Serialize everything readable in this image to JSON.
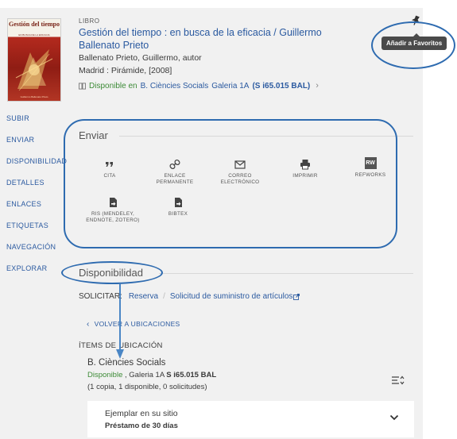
{
  "record": {
    "type_label": "LIBRO",
    "title": "Gestión del tiempo : en busca de la eficacia / Guillermo Ballenato Prieto",
    "author": "Ballenato Prieto, Guillermo, autor",
    "publisher": "Madrid : Pirámide, [2008]",
    "availability": {
      "status": "Disponible en",
      "library": "B. Ciències Socials",
      "location": "Galeria 1A",
      "callnumber": "(S i65.015 BAL)"
    },
    "cover": {
      "title": "Gestión del tiempo",
      "subtitle": "EN BUSCA DE LA EFICACIA",
      "footer": "Guillermo Ballenato Prieto"
    }
  },
  "favorites_tooltip": "Añadir a Favoritos",
  "nav": {
    "items": [
      "SUBIR",
      "ENVIAR",
      "DISPONIBILIDAD",
      "DETALLES",
      "ENLACES",
      "ETIQUETAS",
      "NAVEGACIÓN",
      "EXPLORAR"
    ]
  },
  "send": {
    "title": "Enviar",
    "actions": [
      {
        "label": "CITA",
        "icon": "quote-icon"
      },
      {
        "label": "ENLACE PERMANENTE",
        "icon": "link-icon"
      },
      {
        "label": "CORREO ELECTRÓNICO",
        "icon": "mail-icon"
      },
      {
        "label": "IMPRIMIR",
        "icon": "print-icon"
      },
      {
        "label": "REFWORKS",
        "icon": "refworks-icon",
        "badge": "RW"
      },
      {
        "label": "RIS (MENDELEY, ENDNOTE, ZOTERO)",
        "icon": "file-export-icon"
      },
      {
        "label": "BIBTEX",
        "icon": "file-export-icon"
      }
    ]
  },
  "availability_section": {
    "title": "Disponibilidad",
    "request_label": "SOLICITAR:",
    "request_links": [
      "Reserva",
      "Solicitud de suministro de artículos"
    ],
    "back_label": "VOLVER A UBICACIONES",
    "items_heading": "ÍTEMS DE UBICACIÓN",
    "location": {
      "name": "B. Ciències Socials",
      "status": "Disponible",
      "detail_prefix": " , Galeria 1A ",
      "callnumber": "S i65.015 BAL",
      "counts": "(1 copia, 1 disponible, 0 solicitudes)"
    },
    "item": {
      "line1": "Ejemplar en su sitio",
      "line2": "Préstamo de 30 días"
    }
  },
  "colors": {
    "link": "#2b5aa0",
    "available": "#3d8b37",
    "annotation": "#2e6bb0",
    "panel_bg": "#f1f1f1"
  }
}
